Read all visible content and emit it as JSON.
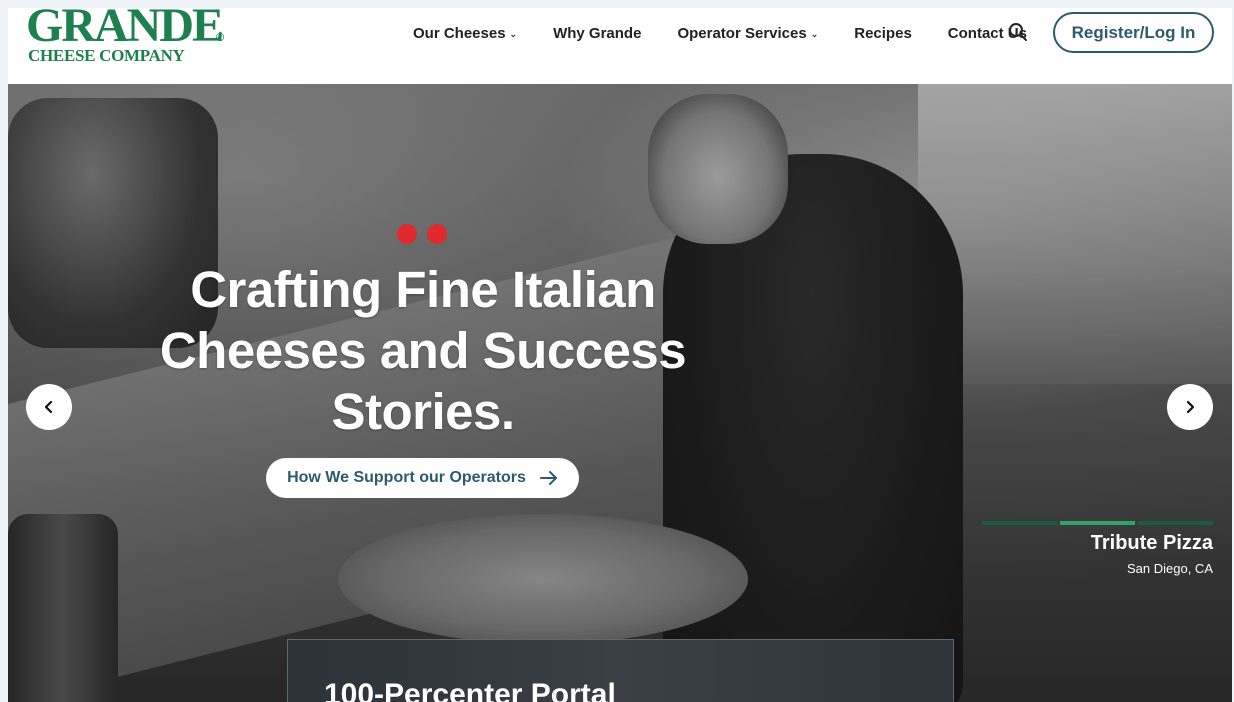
{
  "brand": {
    "logo_top": "GRANDE",
    "logo_reg": "®",
    "logo_bottom": "CHEESE COMPANY",
    "green": "#1e7f4f"
  },
  "nav": {
    "items": [
      {
        "label": "Our Cheeses",
        "has_dropdown": true
      },
      {
        "label": "Why Grande",
        "has_dropdown": false
      },
      {
        "label": "Operator Services",
        "has_dropdown": true
      },
      {
        "label": "Recipes",
        "has_dropdown": false
      },
      {
        "label": "Contact Us",
        "has_dropdown": false
      }
    ],
    "search_icon": "search-icon",
    "register_label": "Register/Log In"
  },
  "hero": {
    "title": "Crafting Fine Italian Cheeses and Success Stories.",
    "cta_label": "How We Support our Operators",
    "caption_name": "Tribute Pizza",
    "caption_location": "San Diego, CA",
    "dot_color": "#e02a2f",
    "slide_count": 3,
    "active_slide": 2
  },
  "portal": {
    "title": "100-Percenter Portal"
  }
}
